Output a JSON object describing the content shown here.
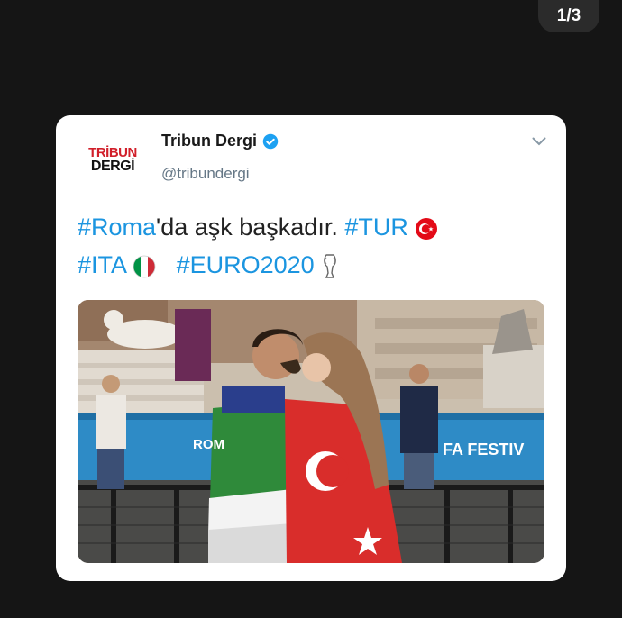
{
  "counter": "1/3",
  "tweet": {
    "avatar_logo_top": "TRİBUN",
    "avatar_logo_bottom": "DERGİ",
    "author_name": "Tribun Dergi",
    "author_handle": "@tribundergi",
    "text": {
      "tag_roma": "#Roma",
      "text_1": "'da aşk başkadır. ",
      "tag_tur": "#TUR",
      "tag_ita": "#ITA",
      "tag_euro": "#EURO2020"
    },
    "media": {
      "banner_left": "ROM",
      "banner_right": "FA FESTIV"
    }
  },
  "colors": {
    "link": "#1b95e0",
    "verified": "#1da1f2",
    "background": "#151515"
  },
  "icons": [
    "verified-badge-icon",
    "chevron-down-icon",
    "turkey-flag-icon",
    "italy-flag-icon",
    "trophy-icon"
  ]
}
